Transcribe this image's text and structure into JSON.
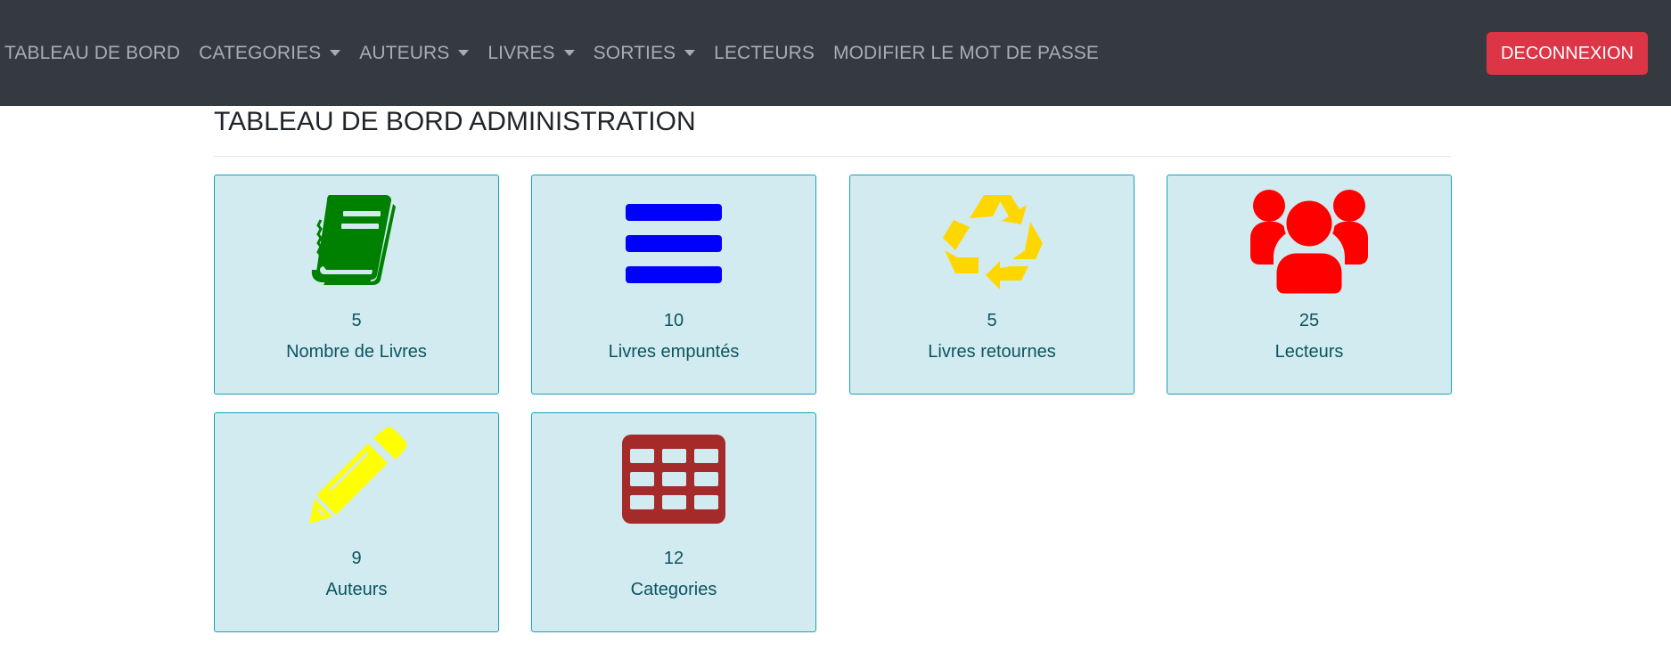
{
  "nav": {
    "items": [
      {
        "label": "TABLEAU DE BORD",
        "dropdown": false
      },
      {
        "label": "CATEGORIES",
        "dropdown": true
      },
      {
        "label": "AUTEURS",
        "dropdown": true
      },
      {
        "label": "LIVRES",
        "dropdown": true
      },
      {
        "label": "SORTIES",
        "dropdown": true
      },
      {
        "label": "LECTEURS",
        "dropdown": false
      },
      {
        "label": "MODIFIER LE MOT DE PASSE",
        "dropdown": false
      }
    ],
    "logout_label": "DECONNEXION"
  },
  "page": {
    "title": "TABLEAU DE BORD ADMINISTRATION"
  },
  "cards": [
    {
      "count": "5",
      "label": "Nombre de Livres",
      "icon": "book-icon",
      "color": "#008000"
    },
    {
      "count": "10",
      "label": "Livres empuntés",
      "icon": "bars-icon",
      "color": "#0000ff"
    },
    {
      "count": "5",
      "label": "Livres retournes",
      "icon": "recycle-icon",
      "color": "#ffd700"
    },
    {
      "count": "25",
      "label": "Lecteurs",
      "icon": "users-icon",
      "color": "#ff0000"
    },
    {
      "count": "9",
      "label": "Auteurs",
      "icon": "pencil-icon",
      "color": "#ffff00"
    },
    {
      "count": "12",
      "label": "Categories",
      "icon": "table-icon",
      "color": "#a52a2a"
    }
  ],
  "colors": {
    "navbar": "#343a40",
    "logout": "#dc3545",
    "card_bg": "#d1ebf0",
    "card_border": "#17a2b8",
    "card_text": "#0c5460"
  }
}
